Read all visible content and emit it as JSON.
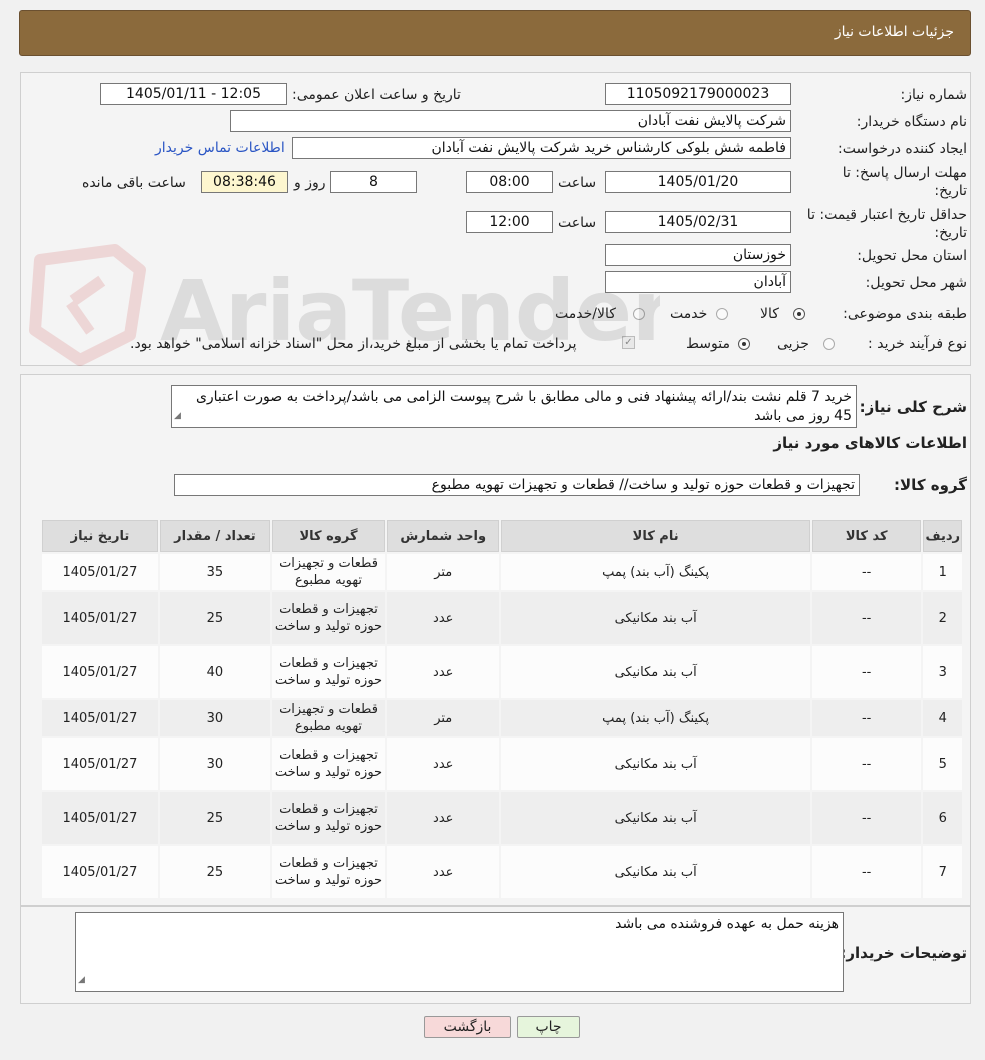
{
  "header": {
    "title": "جزئیات اطلاعات نیاز"
  },
  "fields": {
    "need_number_label": "شماره نیاز:",
    "need_number": "1105092179000023",
    "announce_label": "تاریخ و ساعت اعلان عمومی:",
    "announce_value": "1405/01/11 - 12:05",
    "buyer_org_label": "نام دستگاه خریدار:",
    "buyer_org": "شرکت پالایش نفت آبادان",
    "creator_label": "ایجاد کننده درخواست:",
    "creator": "فاطمه شش بلوکی کارشناس خرید شرکت پالایش نفت آبادان",
    "contact_link": "اطلاعات تماس خریدار",
    "deadline_label": "مهلت ارسال پاسخ: تا",
    "deadline_label2": "تاریخ:",
    "deadline_date": "1405/01/20",
    "time_label": "ساعت",
    "deadline_time": "08:00",
    "days_value": "8",
    "days_label": "روز و",
    "remaining_time": "08:38:46",
    "remaining_label": "ساعت باقی مانده",
    "validity_label": "حداقل تاریخ اعتبار قیمت: تا",
    "validity_label2": "تاریخ:",
    "validity_date": "1405/02/31",
    "validity_time": "12:00",
    "province_label": "استان محل تحویل:",
    "province": "خوزستان",
    "city_label": "شهر محل تحویل:",
    "city": "آبادان",
    "category_label": "طبقه بندی موضوعی:",
    "category_options": [
      "کالا",
      "خدمت",
      "کالا/خدمت"
    ],
    "process_label": "نوع فرآیند خرید :",
    "process_options": [
      "جزیی",
      "متوسط"
    ],
    "payment_note": "پرداخت تمام یا بخشی از مبلغ خرید،از محل \"اسناد خزانه اسلامی\" خواهد بود."
  },
  "summary": {
    "label": "شرح کلی نیاز:",
    "text": "خرید 7 قلم نشت بند/ارائه پیشنهاد فنی و مالی مطابق با شرح پیوست الزامی می باشد/پرداخت به صورت اعتباری 45 روز می باشد",
    "items_title": "اطلاعات کالاهای مورد نیاز",
    "group_label": "گروه کالا:",
    "group_value": "تجهیزات و قطعات حوزه تولید و ساخت//  قطعات و تجهیزات تهویه مطبوع"
  },
  "table": {
    "headers": [
      "ردیف",
      "کد کالا",
      "نام کالا",
      "واحد شمارش",
      "گروه کالا",
      "تعداد / مقدار",
      "تاریخ نیاز"
    ],
    "rows": [
      [
        "1",
        "--",
        "پکینگ (آب بند) پمپ",
        "متر",
        "قطعات و تجهیزات تهویه مطبوع",
        "35",
        "1405/01/27"
      ],
      [
        "2",
        "--",
        "آب بند مکانیکی",
        "عدد",
        "تجهیزات و قطعات حوزه تولید و ساخت",
        "25",
        "1405/01/27"
      ],
      [
        "3",
        "--",
        "آب بند مکانیکی",
        "عدد",
        "تجهیزات و قطعات حوزه تولید و ساخت",
        "40",
        "1405/01/27"
      ],
      [
        "4",
        "--",
        "پکینگ (آب بند) پمپ",
        "متر",
        "قطعات و تجهیزات تهویه مطبوع",
        "30",
        "1405/01/27"
      ],
      [
        "5",
        "--",
        "آب بند مکانیکی",
        "عدد",
        "تجهیزات و قطعات حوزه تولید و ساخت",
        "30",
        "1405/01/27"
      ],
      [
        "6",
        "--",
        "آب بند مکانیکی",
        "عدد",
        "تجهیزات و قطعات حوزه تولید و ساخت",
        "25",
        "1405/01/27"
      ],
      [
        "7",
        "--",
        "آب بند مکانیکی",
        "عدد",
        "تجهیزات و قطعات حوزه تولید و ساخت",
        "25",
        "1405/01/27"
      ]
    ]
  },
  "buyer_notes": {
    "label": "توضیحات خریدار:",
    "text": "هزینه حمل به عهده فروشنده می باشد"
  },
  "buttons": {
    "print": "چاپ",
    "back": "بازگشت"
  },
  "watermark": {
    "text": "AriaTender.neT"
  },
  "colors": {
    "header_bg": "#8b6a3c",
    "link": "#2a55c4",
    "back_button": "#f7d9d9",
    "print_button": "#e6f5dc"
  }
}
